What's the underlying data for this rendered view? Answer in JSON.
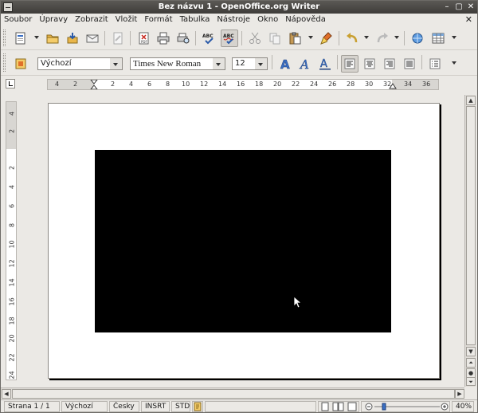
{
  "window": {
    "title": "Bez názvu 1 - OpenOffice.org Writer",
    "controls": {
      "minimize": "–",
      "maximize": "▢",
      "close": "✕"
    }
  },
  "menu": {
    "items": [
      "Soubor",
      "Úpravy",
      "Zobrazit",
      "Vložit",
      "Formát",
      "Tabulka",
      "Nástroje",
      "Okno",
      "Nápověda"
    ],
    "close": "✕"
  },
  "toolbar_standard": {
    "icons": [
      "new-document-icon",
      "open-folder-icon",
      "save-icon",
      "email-icon",
      "edit-file-icon",
      "export-pdf-icon",
      "print-icon",
      "print-preview-icon",
      "spellcheck-icon",
      "autospellcheck-icon",
      "cut-icon",
      "copy-icon",
      "paste-icon",
      "format-paintbrush-icon",
      "undo-icon",
      "redo-icon",
      "navigator-icon",
      "table-icon"
    ],
    "pdf_label": "PDF",
    "abc_label": "ABC"
  },
  "toolbar_formatting": {
    "style": "Výchozí",
    "font": "Times New Roman",
    "size": "12",
    "bold_label": "A",
    "italic_label": "A",
    "underline_label": "A"
  },
  "ruler": {
    "horizontal_ticks": [
      "4",
      "2",
      "2",
      "4",
      "6",
      "8",
      "10",
      "12",
      "14",
      "16",
      "18",
      "20",
      "22",
      "24",
      "26",
      "28",
      "30",
      "32",
      "34",
      "36"
    ],
    "vertical_ticks": [
      "4",
      "2",
      "2",
      "4",
      "6",
      "8",
      "10",
      "12",
      "14",
      "16",
      "18",
      "20",
      "22",
      "24"
    ]
  },
  "document": {
    "image_color": "#000000"
  },
  "statusbar": {
    "page": "Strana 1 / 1",
    "style": "Výchozí",
    "language": "Česky",
    "insert_mode": "INSRT",
    "selection_mode": "STD",
    "zoom": "40%"
  },
  "colors": {
    "accent_blue": "#3a6fc4",
    "titlebar": "#3e3c39"
  }
}
